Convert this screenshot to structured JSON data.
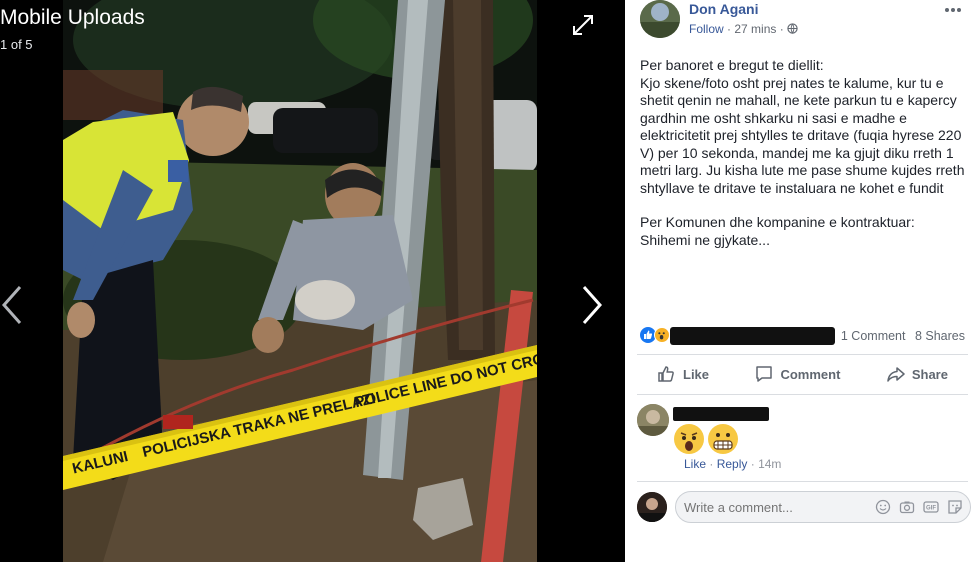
{
  "viewer": {
    "album_title": "Mobile Uploads",
    "position_text": "1 of 5",
    "tape_text_1": "POLICE LINE DO NOT CROSS",
    "tape_text_2": "POLICIJSKA TRAKA NE PRELAZI",
    "tape_text_3": "KALUNI"
  },
  "post": {
    "author": "Don Agani",
    "follow_label": "Follow",
    "separator": "·",
    "time": "27 mins",
    "paragraphs": [
      "Per banoret e bregut te diellit:\nKjo skene/foto osht prej nates te kalume, kur tu e shetit qenin ne mahall, ne kete parkun tu e kapercy gardhin me osht shkarku ni sasi e madhe e elektricitetit prej shtylles te dritave (fuqia hyrese 220 V) per 10 sekonda, mandej me ka gjujt diku rreth 1 metri larg. Ju kisha lute me pase shume kujdes rreth shtyllave te dritave te instaluara ne kohet e fundit",
      "Per Komunen dhe kompanine e kontraktuar:\nShihemi ne gjykate..."
    ],
    "comments_count": "1 Comment",
    "shares_count": "8 Shares"
  },
  "actions": {
    "like": "Like",
    "comment": "Comment",
    "share": "Share"
  },
  "comment": {
    "like": "Like",
    "reply": "Reply",
    "dot": "·",
    "time": "14m"
  },
  "composer": {
    "placeholder": "Write a comment..."
  },
  "colors": {
    "link": "#385898",
    "like_blue": "#1877f2",
    "tape_yellow": "#f3dc19"
  }
}
